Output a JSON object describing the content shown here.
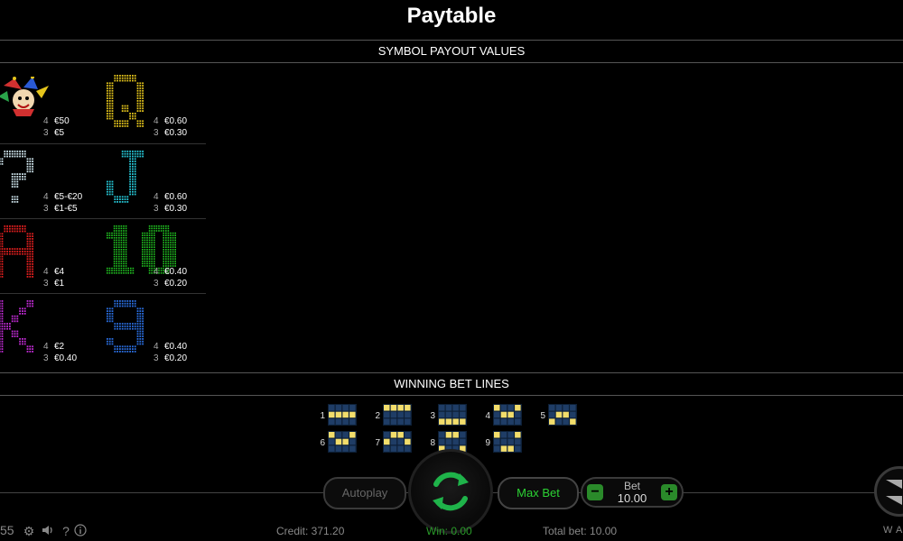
{
  "title": "Paytable",
  "payout_section": {
    "heading": "SYMBOL PAYOUT VALUES",
    "symbols": [
      {
        "id": "joker",
        "glyph": "",
        "color": "#e04040",
        "pays": [
          {
            "count": "4",
            "amount": "€50"
          },
          {
            "count": "3",
            "amount": "€5"
          }
        ]
      },
      {
        "id": "q",
        "glyph": "Q",
        "color": "#e5c51c",
        "pays": [
          {
            "count": "4",
            "amount": "€0.60"
          },
          {
            "count": "3",
            "amount": "€0.30"
          }
        ]
      },
      {
        "id": "scatter",
        "glyph": "?",
        "color": "#cfe6ee",
        "pays": [
          {
            "count": "4",
            "amount": "€5-€20"
          },
          {
            "count": "3",
            "amount": "€1-€5"
          }
        ]
      },
      {
        "id": "j",
        "glyph": "J",
        "color": "#26c6d6",
        "pays": [
          {
            "count": "4",
            "amount": "€0.60"
          },
          {
            "count": "3",
            "amount": "€0.30"
          }
        ]
      },
      {
        "id": "a",
        "glyph": "A",
        "color": "#e01e1e",
        "pays": [
          {
            "count": "4",
            "amount": "€4"
          },
          {
            "count": "3",
            "amount": "€1"
          }
        ]
      },
      {
        "id": "ten",
        "glyph": "10",
        "color": "#22c822",
        "pays": [
          {
            "count": "4",
            "amount": "€0.40"
          },
          {
            "count": "3",
            "amount": "€0.20"
          }
        ]
      },
      {
        "id": "k",
        "glyph": "K",
        "color": "#c22bd6",
        "pays": [
          {
            "count": "4",
            "amount": "€2"
          },
          {
            "count": "3",
            "amount": "€0.40"
          }
        ]
      },
      {
        "id": "nine",
        "glyph": "9",
        "color": "#2a6ee0",
        "pays": [
          {
            "count": "4",
            "amount": "€0.40"
          },
          {
            "count": "3",
            "amount": "€0.20"
          }
        ]
      }
    ]
  },
  "lines_section": {
    "heading": "WINNING BET LINES",
    "cell_on": "#f2dd6b",
    "cell_off": "#1f3d66",
    "lines": [
      {
        "num": "1",
        "pattern": [
          [
            0,
            0,
            0,
            0
          ],
          [
            1,
            1,
            1,
            1
          ],
          [
            0,
            0,
            0,
            0
          ]
        ]
      },
      {
        "num": "2",
        "pattern": [
          [
            1,
            1,
            1,
            1
          ],
          [
            0,
            0,
            0,
            0
          ],
          [
            0,
            0,
            0,
            0
          ]
        ]
      },
      {
        "num": "3",
        "pattern": [
          [
            0,
            0,
            0,
            0
          ],
          [
            0,
            0,
            0,
            0
          ],
          [
            1,
            1,
            1,
            1
          ]
        ]
      },
      {
        "num": "4",
        "pattern": [
          [
            1,
            0,
            0,
            1
          ],
          [
            0,
            1,
            1,
            0
          ],
          [
            0,
            0,
            0,
            0
          ]
        ]
      },
      {
        "num": "5",
        "pattern": [
          [
            0,
            0,
            0,
            0
          ],
          [
            0,
            1,
            1,
            0
          ],
          [
            1,
            0,
            0,
            1
          ]
        ]
      },
      {
        "num": "6",
        "pattern": [
          [
            1,
            0,
            0,
            1
          ],
          [
            0,
            1,
            1,
            0
          ],
          [
            0,
            0,
            0,
            0
          ]
        ]
      },
      {
        "num": "7",
        "pattern": [
          [
            0,
            1,
            1,
            0
          ],
          [
            1,
            0,
            0,
            1
          ],
          [
            0,
            0,
            0,
            0
          ]
        ]
      },
      {
        "num": "8",
        "pattern": [
          [
            0,
            1,
            1,
            0
          ],
          [
            0,
            0,
            0,
            0
          ],
          [
            1,
            0,
            0,
            1
          ]
        ]
      },
      {
        "num": "9",
        "pattern": [
          [
            1,
            0,
            0,
            1
          ],
          [
            0,
            0,
            0,
            0
          ],
          [
            0,
            1,
            1,
            0
          ]
        ]
      }
    ]
  },
  "controls": {
    "autoplay_label": "Autoplay",
    "max_bet_label": "Max Bet",
    "bet_label": "Bet",
    "bet_value": "10.00",
    "minus": "−",
    "plus": "+"
  },
  "status": {
    "credit": "Credit: 371.20",
    "win": "Win: 0.00",
    "total_bet": "Total bet: 10.00"
  },
  "footer": {
    "clock": "55",
    "brand": "WAT"
  },
  "colors": {
    "spin_accent": "#1fb34a",
    "win_green": "#2a9a2a"
  }
}
